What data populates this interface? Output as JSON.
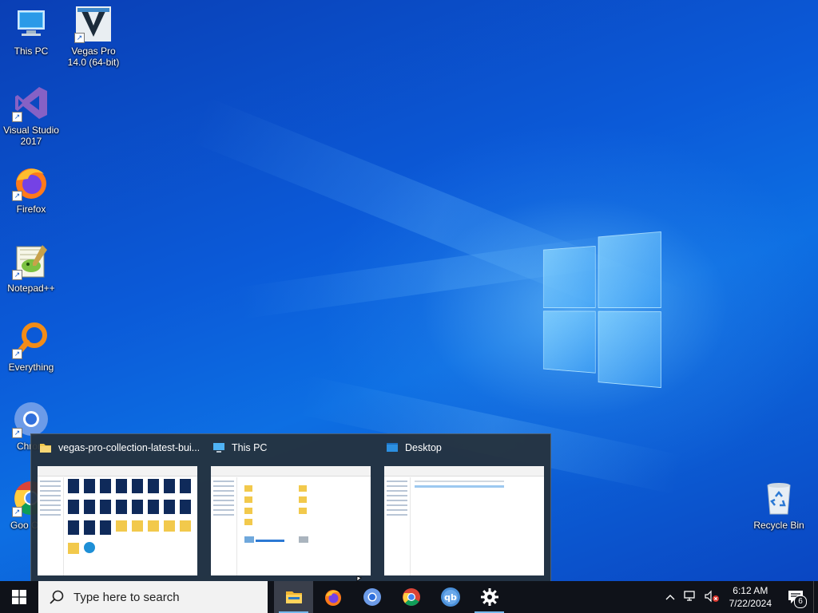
{
  "desktop": {
    "icons": [
      {
        "label": "This PC",
        "icon": "this-pc-icon"
      },
      {
        "label": "Vegas Pro 14.0 (64-bit)",
        "icon": "vegas-pro-icon"
      },
      {
        "label": "Visual Studio 2017",
        "icon": "visual-studio-icon"
      },
      {
        "label": "Firefox",
        "icon": "firefox-icon"
      },
      {
        "label": "Notepad++",
        "icon": "notepad-plus-plus-icon"
      },
      {
        "label": "Everything",
        "icon": "everything-icon"
      },
      {
        "label": "Chrom",
        "icon": "chromium-icon"
      },
      {
        "label": "Goo Chro",
        "icon": "google-chrome-icon"
      },
      {
        "label": "Recycle Bin",
        "icon": "recycle-bin-icon"
      }
    ]
  },
  "task_view": {
    "windows": [
      {
        "title": "vegas-pro-collection-latest-bui...",
        "icon": "folder-icon"
      },
      {
        "title": "This PC",
        "icon": "this-pc-icon"
      },
      {
        "title": "Desktop",
        "icon": "desktop-folder-icon"
      }
    ]
  },
  "taskbar": {
    "search_placeholder": "Type here to search",
    "apps": [
      {
        "name": "File Explorer",
        "icon": "file-explorer-icon",
        "running": true,
        "active": true
      },
      {
        "name": "Firefox",
        "icon": "firefox-icon",
        "running": false,
        "active": false
      },
      {
        "name": "Chromium",
        "icon": "chromium-icon",
        "running": false,
        "active": false
      },
      {
        "name": "Google Chrome",
        "icon": "google-chrome-icon",
        "running": false,
        "active": false
      },
      {
        "name": "qBittorrent",
        "icon": "qbittorrent-icon",
        "running": false,
        "active": false
      },
      {
        "name": "Settings",
        "icon": "settings-icon",
        "running": true,
        "active": false
      }
    ],
    "tray": {
      "time": "6:12 AM",
      "date": "7/22/2024",
      "notification_count": "6"
    }
  },
  "colors": {
    "wallpaper": "#0b5ad8",
    "taskbar": "#0f1219",
    "accent": "#76b9ed"
  }
}
